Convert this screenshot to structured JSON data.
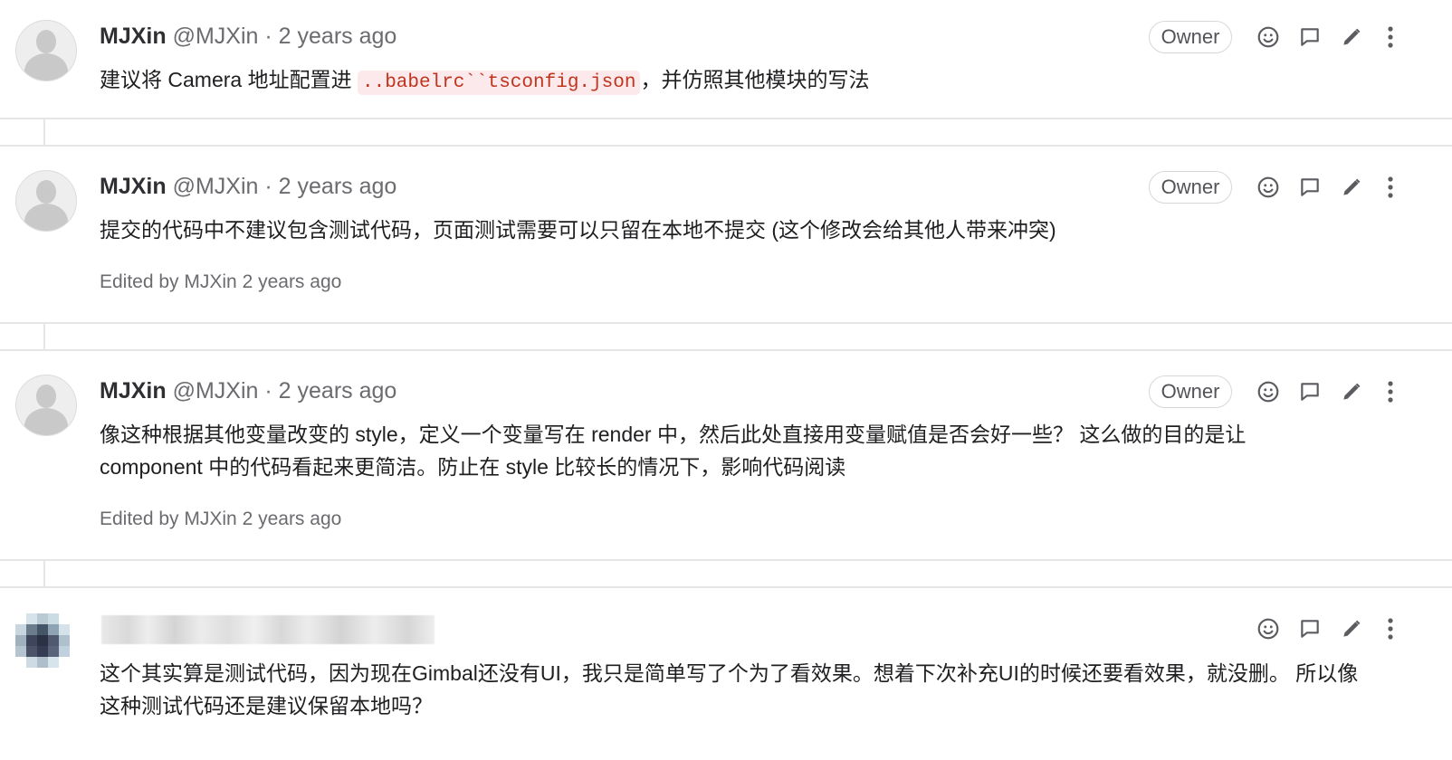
{
  "notes": [
    {
      "author_name": "MJXin",
      "author_handle": "@MJXin",
      "separator": "·",
      "timestamp": "2 years ago",
      "badge": "Owner",
      "body_before": "建议将 Camera 地址配置进 ",
      "code": "..babelrc``tsconfig.json",
      "body_after": "，并仿照其他模块的写法"
    },
    {
      "author_name": "MJXin",
      "author_handle": "@MJXin",
      "separator": "·",
      "timestamp": "2 years ago",
      "badge": "Owner",
      "body": "提交的代码中不建议包含测试代码，页面测试需要可以只留在本地不提交 (这个修改会给其他人带来冲突)",
      "edited": "Edited by MJXin 2 years ago"
    },
    {
      "author_name": "MJXin",
      "author_handle": "@MJXin",
      "separator": "·",
      "timestamp": "2 years ago",
      "badge": "Owner",
      "body_line1": "像这种根据其他变量改变的 style，定义一个变量写在 render 中，然后此处直接用变量赋值是否会好一些？ 这么做的目的是让",
      "body_line2": "component 中的代码看起来更简洁。防止在 style 比较长的情况下，影响代码阅读",
      "edited": "Edited by MJXin 2 years ago"
    },
    {
      "body_line1": "这个其实算是测试代码，因为现在Gimbal还没有UI，我只是简单写了个为了看效果。想着下次补充UI的时候还要看效果，就没删。 所以像",
      "body_line2": "这种测试代码还是建议保留本地吗？"
    }
  ],
  "actions": [
    "smiley-icon",
    "reply-icon",
    "edit-icon",
    "more-icon"
  ],
  "colors": {
    "code_text": "#c0341d",
    "code_bg": "#fbe9eb",
    "border": "#e6e6e8",
    "muted": "#6b6b70"
  }
}
